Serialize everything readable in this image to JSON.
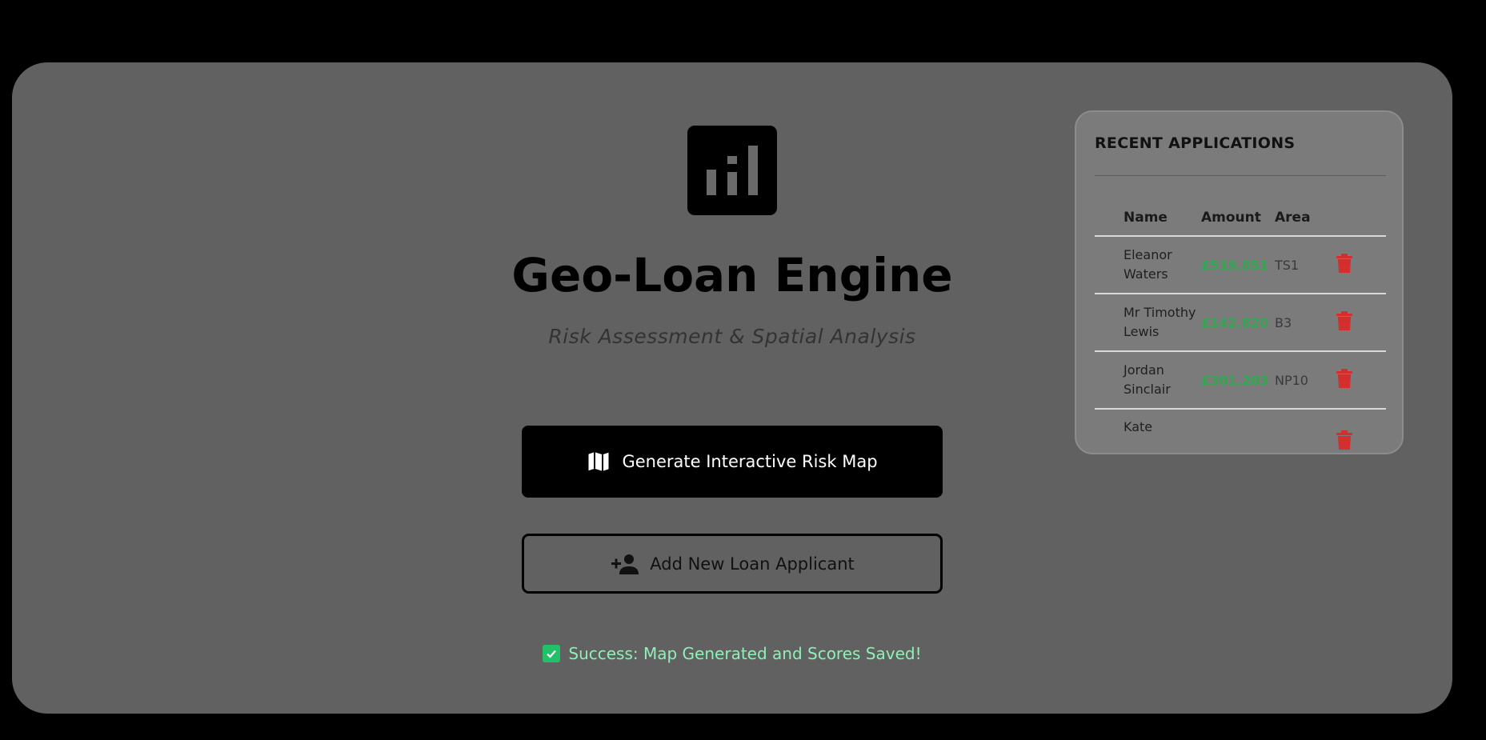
{
  "app": {
    "title": "Geo-Loan Engine",
    "subtitle": "Risk Assessment & Spatial Analysis",
    "logo_icon": "bar-chart-icon"
  },
  "actions": {
    "generate_label": "Generate Interactive Risk Map",
    "generate_icon": "map-icon",
    "add_label": "Add New Loan Applicant",
    "add_icon": "person-add-icon"
  },
  "status": {
    "message": "Success: Map Generated and Scores Saved!",
    "icon": "check-icon",
    "color": "#8ef0b6"
  },
  "recent": {
    "title": "RECENT APPLICATIONS",
    "columns": [
      "Name",
      "Amount",
      "Area",
      ""
    ],
    "rows": [
      {
        "name": "Eleanor Waters",
        "amount": "£519,851",
        "area": "TS1"
      },
      {
        "name": "Mr Timothy Lewis",
        "amount": "£142,820",
        "area": "B3"
      },
      {
        "name": "Jordan Sinclair",
        "amount": "£301,203",
        "area": "NP10"
      },
      {
        "name": "Kate",
        "amount": "",
        "area": ""
      }
    ]
  },
  "colors": {
    "amount": "#2fa84f",
    "delete": "#d32f2f",
    "panel": "#616161"
  }
}
